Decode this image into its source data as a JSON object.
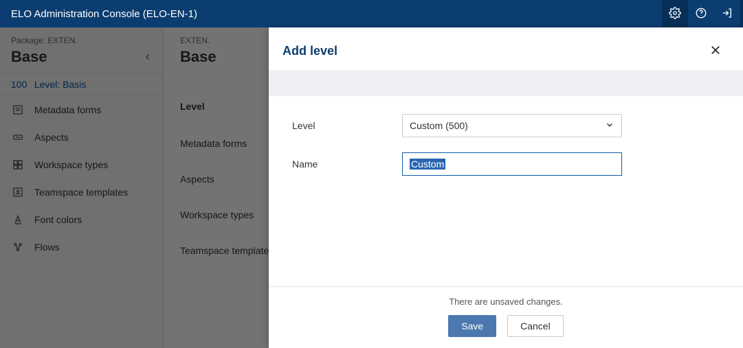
{
  "topbar": {
    "title": "ELO Administration Console (ELO-EN-1)"
  },
  "sidebar": {
    "package_label": "Package: EXTEN.",
    "title": "Base",
    "level": {
      "number": "100",
      "text": "Level: Basis"
    },
    "items": [
      {
        "label": "Metadata forms"
      },
      {
        "label": "Aspects"
      },
      {
        "label": "Workspace types"
      },
      {
        "label": "Teamspace templates"
      },
      {
        "label": "Font colors"
      },
      {
        "label": "Flows"
      }
    ]
  },
  "content": {
    "package_label": "EXTEN.",
    "title": "Base",
    "section_label": "Level",
    "rows": [
      "Metadata forms",
      "Aspects",
      "Workspace types",
      "Teamspace templates"
    ]
  },
  "modal": {
    "title": "Add level",
    "fields": {
      "level": {
        "label": "Level",
        "value": "Custom (500)"
      },
      "name": {
        "label": "Name",
        "value": "Custom"
      }
    },
    "footer": {
      "unsaved": "There are unsaved changes.",
      "save": "Save",
      "cancel": "Cancel"
    }
  }
}
